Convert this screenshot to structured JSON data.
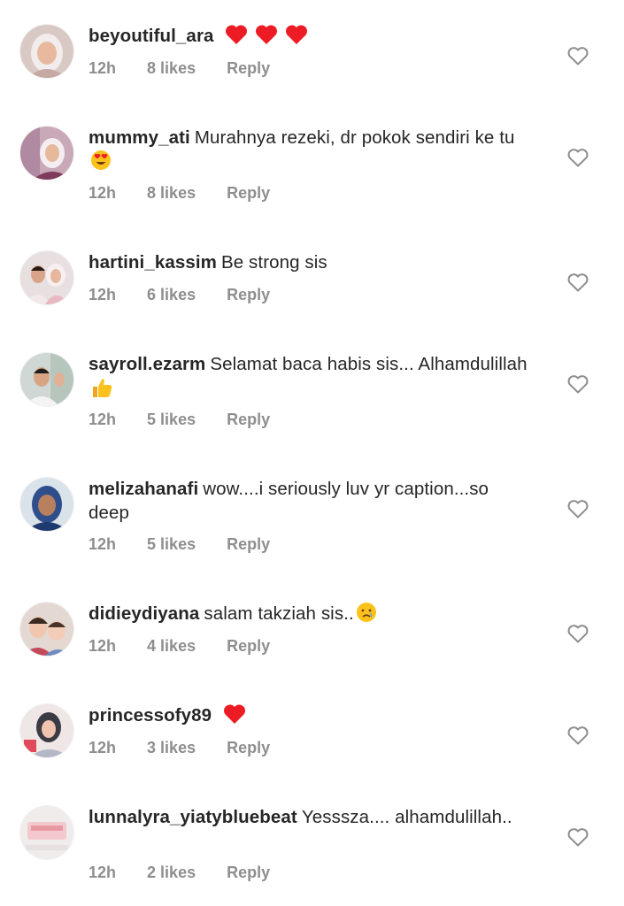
{
  "comments": [
    {
      "username": "beyoutiful_ara",
      "text": "",
      "emoji": [
        "red-heart",
        "red-heart",
        "red-heart"
      ],
      "time": "12h",
      "likes": "8 likes",
      "reply": "Reply"
    },
    {
      "username": "mummy_ati",
      "text": "Murahnya rezeki, dr pokok sendiri ke tu",
      "emoji": [
        "heart-eyes"
      ],
      "time": "12h",
      "likes": "8 likes",
      "reply": "Reply"
    },
    {
      "username": "hartini_kassim",
      "text": "Be strong sis",
      "emoji": [],
      "time": "12h",
      "likes": "6 likes",
      "reply": "Reply"
    },
    {
      "username": "sayroll.ezarm",
      "text": "Selamat baca habis sis... Alhamdulillah",
      "emoji": [
        "thumbs-up"
      ],
      "time": "12h",
      "likes": "5 likes",
      "reply": "Reply"
    },
    {
      "username": "melizahanafi",
      "text": "wow....i seriously luv yr caption...so deep",
      "emoji": [],
      "time": "12h",
      "likes": "5 likes",
      "reply": "Reply"
    },
    {
      "username": "didieydiyana",
      "text": "salam takziah sis..",
      "emoji": [
        "crying-face"
      ],
      "time": "12h",
      "likes": "4 likes",
      "reply": "Reply"
    },
    {
      "username": "princessofy89",
      "text": "",
      "emoji": [
        "red-heart"
      ],
      "time": "12h",
      "likes": "3 likes",
      "reply": "Reply"
    },
    {
      "username": "lunnalyra_yiatybluebeat",
      "text": "Yesssza.... alhamdulillah..",
      "emoji": [],
      "time": "12h",
      "likes": "2 likes",
      "reply": "Reply"
    }
  ],
  "colors": {
    "text": "#262626",
    "meta": "#8e8e8e",
    "heart_outline": "#8e8e8e",
    "emoji_heart": "#ed1c24",
    "emoji_face": "#fcc21b"
  },
  "icons": {
    "like": "heart-outline-icon"
  }
}
